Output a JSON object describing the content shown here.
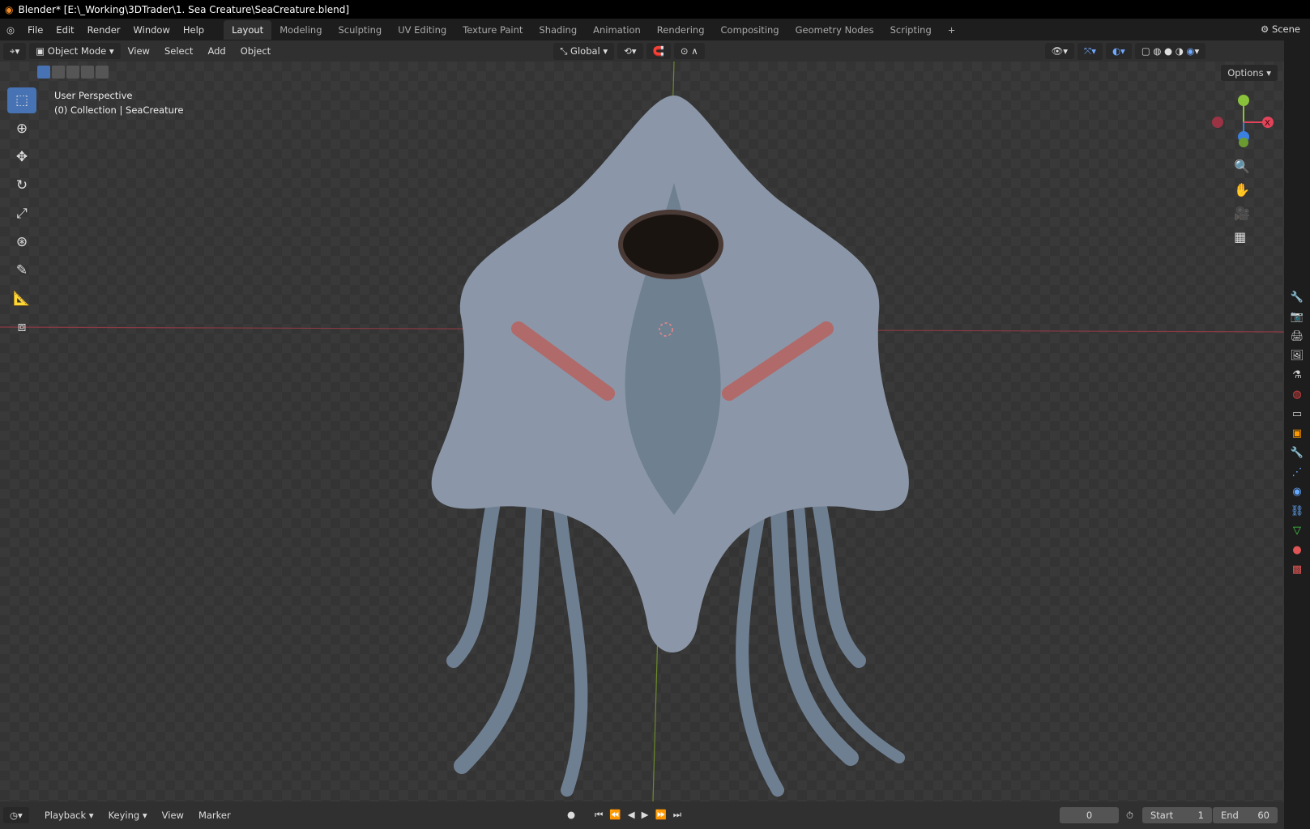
{
  "window_title": "Blender* [E:\\_Working\\3DTrader\\1. Sea Creature\\SeaCreature.blend]",
  "menu": [
    "File",
    "Edit",
    "Render",
    "Window",
    "Help"
  ],
  "workspaces": [
    "Layout",
    "Modeling",
    "Sculpting",
    "UV Editing",
    "Texture Paint",
    "Shading",
    "Animation",
    "Rendering",
    "Compositing",
    "Geometry Nodes",
    "Scripting",
    "+"
  ],
  "scene_label": "Scene",
  "header": {
    "mode": "Object Mode",
    "menus": [
      "View",
      "Select",
      "Add",
      "Object"
    ],
    "orientation": "Global",
    "options": "Options"
  },
  "viewport": {
    "perspective": "User Perspective",
    "collection": "(0) Collection | SeaCreature"
  },
  "gizmo": {
    "x_label": "X"
  },
  "timeline": {
    "menus": [
      "Playback",
      "Keying",
      "View",
      "Marker"
    ],
    "current_frame": "0",
    "start_label": "Start",
    "start": "1",
    "end_label": "End",
    "end": "60"
  }
}
